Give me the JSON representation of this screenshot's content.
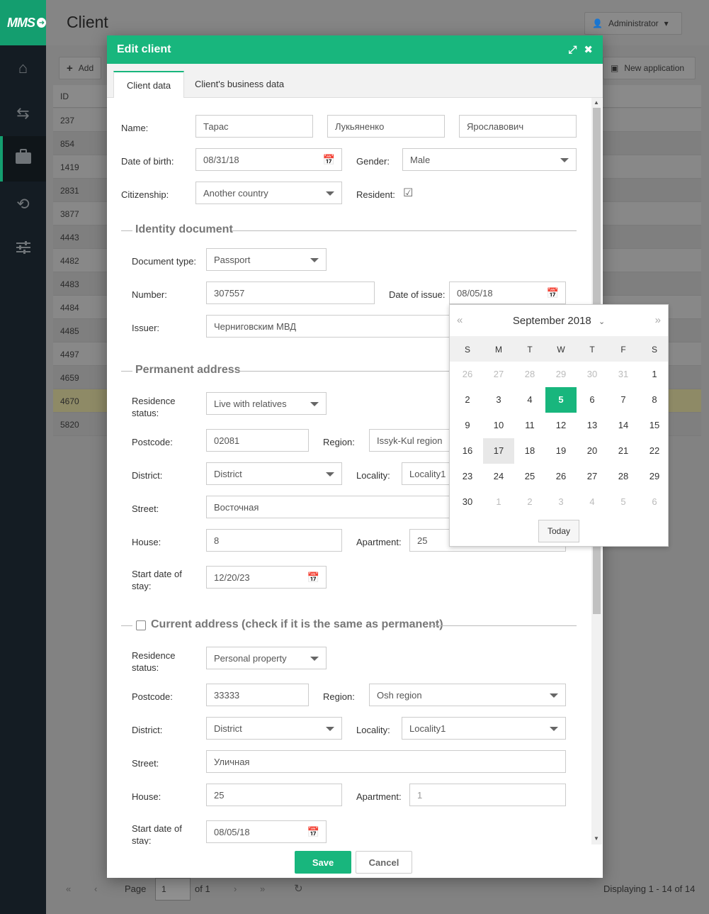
{
  "app": {
    "logo": "MMS",
    "page_title": "Client",
    "admin_label": "Administrator",
    "nav_icons": [
      "home-icon",
      "exchange-icon",
      "briefcase-icon",
      "history-icon",
      "sliders-icon"
    ]
  },
  "toolbar": {
    "add_label": "Add",
    "new_application_label": "New application"
  },
  "grid": {
    "id_header": "ID",
    "rows": [
      "237",
      "854",
      "1419",
      "2831",
      "3877",
      "4443",
      "4482",
      "4483",
      "4484",
      "4485",
      "4497",
      "4659",
      "4670",
      "5820"
    ],
    "selected_row": "4670"
  },
  "pager": {
    "page_label": "Page",
    "page_value": "1",
    "of_label": "of 1",
    "displaying": "Displaying 1 - 14 of 14"
  },
  "modal": {
    "title": "Edit client",
    "tabs": [
      "Client data",
      "Client's business data"
    ],
    "name_label": "Name:",
    "name_first": "Тарас",
    "name_last": "Лукьяненко",
    "name_middle": "Ярославович",
    "dob_label": "Date of birth:",
    "dob_value": "08/31/18",
    "gender_label": "Gender:",
    "gender_value": "Male",
    "citizenship_label": "Citizenship:",
    "citizenship_value": "Another country",
    "resident_label": "Resident:",
    "identity": {
      "title": "Identity document",
      "doc_type_label": "Document type:",
      "doc_type_value": "Passport",
      "number_label": "Number:",
      "number_value": "307557",
      "issue_label": "Date of issue:",
      "issue_value": "08/05/18",
      "issuer_label": "Issuer:",
      "issuer_value": "Черниговским МВД"
    },
    "permanent": {
      "title": "Permanent address",
      "residence_label_1": "Residence",
      "residence_label_2": "status:",
      "residence_value": "Live with relatives",
      "postcode_label": "Postcode:",
      "postcode_value": "02081",
      "region_label": "Region:",
      "region_value": "Issyk-Kul region",
      "district_label": "District:",
      "district_value": "District",
      "locality_label": "Locality:",
      "locality_value": "Locality1",
      "street_label": "Street:",
      "street_value": "Восточная",
      "house_label": "House:",
      "house_value": "8",
      "apartment_label": "Apartment:",
      "apartment_value": "25",
      "start_label_1": "Start date of",
      "start_label_2": "stay:",
      "start_value": "12/20/23"
    },
    "current": {
      "title": "Current address (check if it is the same as permanent)",
      "residence_label_1": "Residence",
      "residence_label_2": "status:",
      "residence_value": "Personal property",
      "postcode_label": "Postcode:",
      "postcode_value": "33333",
      "region_label": "Region:",
      "region_value": "Osh region",
      "district_label": "District:",
      "district_value": "District",
      "locality_label": "Locality:",
      "locality_value": "Locality1",
      "street_label": "Street:",
      "street_value": "Уличная",
      "house_label": "House:",
      "house_value": "25",
      "apartment_label": "Apartment:",
      "apartment_placeholder": "1",
      "start_label_1": "Start date of",
      "start_label_2": "stay:",
      "start_value": "08/05/18"
    },
    "save_label": "Save",
    "cancel_label": "Cancel"
  },
  "calendar": {
    "month_label": "September 2018",
    "weekdays": [
      "S",
      "M",
      "T",
      "W",
      "T",
      "F",
      "S"
    ],
    "weeks": [
      [
        "26",
        "27",
        "28",
        "29",
        "30",
        "31",
        "1"
      ],
      [
        "2",
        "3",
        "4",
        "5",
        "6",
        "7",
        "8"
      ],
      [
        "9",
        "10",
        "11",
        "12",
        "13",
        "14",
        "15"
      ],
      [
        "16",
        "17",
        "18",
        "19",
        "20",
        "21",
        "22"
      ],
      [
        "23",
        "24",
        "25",
        "26",
        "27",
        "28",
        "29"
      ],
      [
        "30",
        "1",
        "2",
        "3",
        "4",
        "5",
        "6"
      ]
    ],
    "selected_day": "5",
    "hover_day": "17",
    "today_label": "Today",
    "accent_color": "#18b67d"
  }
}
